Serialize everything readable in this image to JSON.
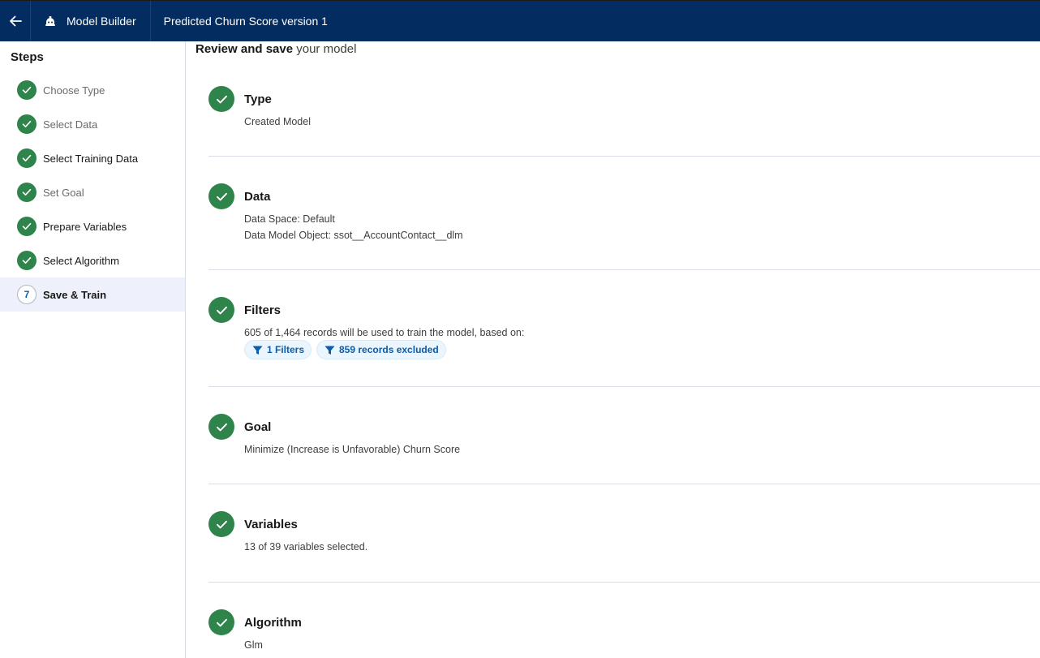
{
  "header": {
    "back_icon": "arrow-left-icon",
    "app_icon": "einstein-icon",
    "app_title": "Model Builder",
    "model_title": "Predicted Churn Score version 1"
  },
  "sidebar": {
    "title": "Steps",
    "steps": [
      {
        "label": "Choose Type",
        "status": "done"
      },
      {
        "label": "Select Data",
        "status": "done"
      },
      {
        "label": "Select Training Data",
        "status": "done"
      },
      {
        "label": "Set Goal",
        "status": "done"
      },
      {
        "label": "Prepare Variables",
        "status": "done"
      },
      {
        "label": "Select Algorithm",
        "status": "done"
      },
      {
        "label": "Save & Train",
        "status": "active",
        "number": "7"
      }
    ]
  },
  "main": {
    "heading_bold": "Review and save",
    "heading_rest": "your model",
    "sections": {
      "type": {
        "title": "Type",
        "lines": [
          "Created Model"
        ]
      },
      "data": {
        "title": "Data",
        "lines": [
          "Data Space: Default",
          "Data Model Object: ssot__AccountContact__dlm"
        ]
      },
      "filters": {
        "title": "Filters",
        "lines": [
          "605 of 1,464 records will be used to train the model, based on:"
        ],
        "pills": [
          "1 Filters",
          "859 records excluded"
        ]
      },
      "goal": {
        "title": "Goal",
        "lines": [
          "Minimize (Increase is Unfavorable) Churn Score"
        ]
      },
      "variables": {
        "title": "Variables",
        "lines": [
          "13 of 39 variables selected."
        ]
      },
      "algorithm": {
        "title": "Algorithm",
        "lines": [
          "Glm"
        ]
      }
    }
  },
  "colors": {
    "header_bg": "#032d60",
    "success": "#2e844a",
    "brand_blue": "#0b5cab",
    "active_step_bg": "#eef1fb"
  }
}
